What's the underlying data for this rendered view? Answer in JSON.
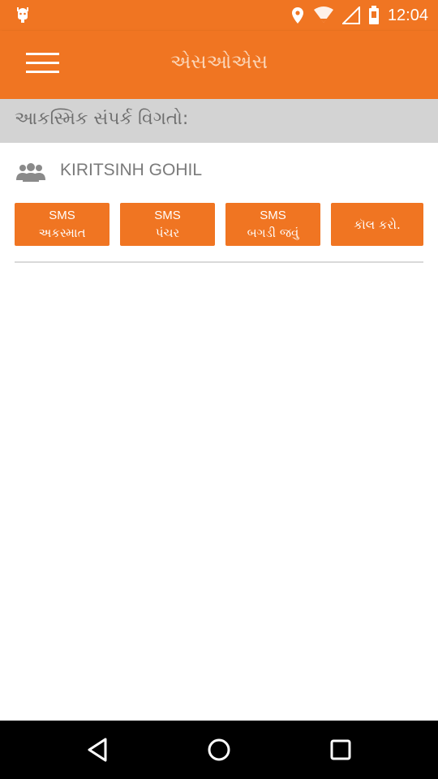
{
  "status_bar": {
    "time": "12:04",
    "icons": [
      "android-notification-icon",
      "location-icon",
      "wifi-icon",
      "battery-icon"
    ]
  },
  "app_bar": {
    "title": "એસઓએસ",
    "menu_icon": "hamburger-menu-icon"
  },
  "section": {
    "title": "આકસ્મિક સંપર્ક વિગતો:"
  },
  "contact": {
    "icon": "group-icon",
    "name": "KIRITSINH GOHIL"
  },
  "actions": [
    {
      "line1": "SMS",
      "line2": "અકસ્માત"
    },
    {
      "line1": "SMS",
      "line2": "પંચર"
    },
    {
      "line1": "SMS",
      "line2": "બગડી જવું"
    },
    {
      "line1": "",
      "line2": "કૉલ કરો."
    }
  ],
  "nav_bar": {
    "icons": [
      "back-icon",
      "home-icon",
      "recents-icon"
    ]
  },
  "colors": {
    "accent": "#f07522",
    "header_bg": "#d3d3d3",
    "text_gray": "#7a7a7a"
  }
}
